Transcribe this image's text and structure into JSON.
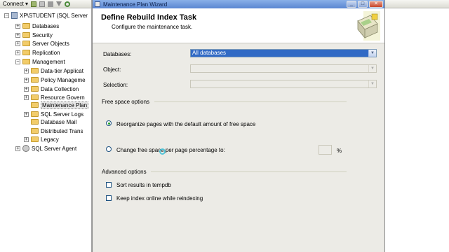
{
  "object_explorer": {
    "connect_label": "Connect ▾",
    "items": [
      {
        "label": "XP\\STUDENT (SQL Server",
        "icon": "server-icon",
        "expander": "−",
        "level": 0
      },
      {
        "label": "Databases",
        "icon": "folder-icon",
        "expander": "+",
        "level": 1
      },
      {
        "label": "Security",
        "icon": "folder-icon",
        "expander": "+",
        "level": 1
      },
      {
        "label": "Server Objects",
        "icon": "folder-icon",
        "expander": "+",
        "level": 1
      },
      {
        "label": "Replication",
        "icon": "folder-icon",
        "expander": "+",
        "level": 1
      },
      {
        "label": "Management",
        "icon": "folder-icon",
        "expander": "−",
        "level": 1
      },
      {
        "label": "Data-tier Applicat",
        "icon": "folder-icon",
        "expander": "+",
        "level": 2
      },
      {
        "label": "Policy Manageme",
        "icon": "folder-icon",
        "expander": "+",
        "level": 2
      },
      {
        "label": "Data Collection",
        "icon": "folder-icon",
        "expander": "+",
        "level": 2
      },
      {
        "label": "Resource Govern",
        "icon": "folder-icon",
        "expander": "+",
        "level": 2
      },
      {
        "label": "Maintenance Plan",
        "icon": "folder-icon",
        "expander": "",
        "level": 2,
        "selected": true
      },
      {
        "label": "SQL Server Logs",
        "icon": "folder-icon",
        "expander": "+",
        "level": 2
      },
      {
        "label": "Database Mail",
        "icon": "folder-icon",
        "expander": "",
        "level": 2
      },
      {
        "label": "Distributed Trans",
        "icon": "folder-icon",
        "expander": "",
        "level": 2
      },
      {
        "label": "Legacy",
        "icon": "folder-icon",
        "expander": "+",
        "level": 2
      },
      {
        "label": "SQL Server Agent",
        "icon": "agent-icon",
        "expander": "+",
        "level": 1
      }
    ]
  },
  "wizard": {
    "window_title": "Maintenance Plan Wizard",
    "header_title": "Define Rebuild Index Task",
    "header_subtitle": "Configure the maintenance task.",
    "databases_label": "Databases:",
    "databases_value": "All databases",
    "object_label": "Object:",
    "object_value": "",
    "selection_label": "Selection:",
    "selection_value": "",
    "free_space_title": "Free space options",
    "radio_reorganize": "Reorganize pages with the default amount of free space",
    "radio_change": "Change free space per page percentage to:",
    "percent_value": "",
    "percent_unit": "%",
    "advanced_title": "Advanced options",
    "check_sort": "Sort results in tempdb",
    "check_keep_online": "Keep index online while reindexing",
    "selected_option": "reorganize"
  },
  "colors": {
    "selection_blue": "#316ac5",
    "title_gradient_top": "#8ab0e8",
    "radio_dot": "#21a121"
  }
}
